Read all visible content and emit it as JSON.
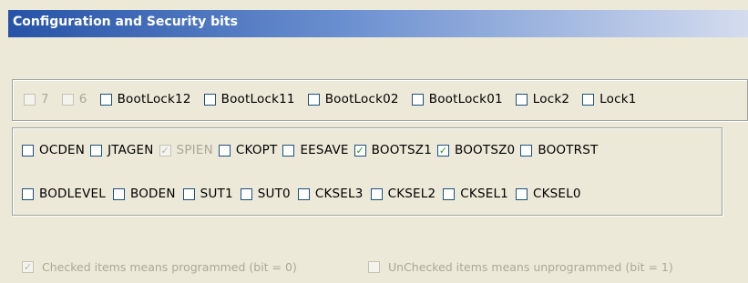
{
  "title": "Configuration and Security bits",
  "rows": [
    [
      {
        "label": "7",
        "checked": false,
        "enabled": false
      },
      {
        "label": "6",
        "checked": false,
        "enabled": false
      },
      {
        "label": "BootLock12",
        "checked": false,
        "enabled": true
      },
      {
        "label": "BootLock11",
        "checked": false,
        "enabled": true
      },
      {
        "label": "BootLock02",
        "checked": false,
        "enabled": true
      },
      {
        "label": "BootLock01",
        "checked": false,
        "enabled": true
      },
      {
        "label": "Lock2",
        "checked": false,
        "enabled": true
      },
      {
        "label": "Lock1",
        "checked": false,
        "enabled": true
      }
    ],
    [
      {
        "label": "OCDEN",
        "checked": false,
        "enabled": true
      },
      {
        "label": "JTAGEN",
        "checked": false,
        "enabled": true
      },
      {
        "label": "SPIEN",
        "checked": true,
        "enabled": false
      },
      {
        "label": "CKOPT",
        "checked": false,
        "enabled": true
      },
      {
        "label": "EESAVE",
        "checked": false,
        "enabled": true
      },
      {
        "label": "BOOTSZ1",
        "checked": true,
        "enabled": true
      },
      {
        "label": "BOOTSZ0",
        "checked": true,
        "enabled": true
      },
      {
        "label": "BOOTRST",
        "checked": false,
        "enabled": true
      }
    ],
    [
      {
        "label": "BODLEVEL",
        "checked": false,
        "enabled": true
      },
      {
        "label": "BODEN",
        "checked": false,
        "enabled": true
      },
      {
        "label": "SUT1",
        "checked": false,
        "enabled": true
      },
      {
        "label": "SUT0",
        "checked": false,
        "enabled": true
      },
      {
        "label": "CKSEL3",
        "checked": false,
        "enabled": true
      },
      {
        "label": "CKSEL2",
        "checked": false,
        "enabled": true
      },
      {
        "label": "CKSEL1",
        "checked": false,
        "enabled": true
      },
      {
        "label": "CKSEL0",
        "checked": false,
        "enabled": true
      }
    ]
  ],
  "legend": {
    "checked": {
      "label": "Checked items means programmed (bit = 0)",
      "checked": true
    },
    "unchecked": {
      "label": "UnChecked items means unprogrammed (bit = 1)",
      "checked": false
    }
  },
  "colors": {
    "title_bar": "#2653a7",
    "check_mark": "#21a121",
    "disabled_text": "#aca899",
    "background": "#ece9d8"
  }
}
